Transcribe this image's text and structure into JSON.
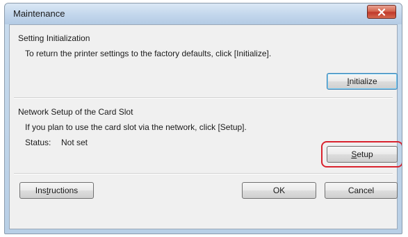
{
  "window": {
    "title": "Maintenance"
  },
  "setting_init": {
    "heading": "Setting Initialization",
    "description": "To return the printer settings to the factory defaults, click [Initialize].",
    "button": {
      "before": "",
      "accel": "I",
      "after": "nitialize"
    }
  },
  "network": {
    "heading": "Network Setup of the Card Slot",
    "description": "If you plan to use the card slot via the network, click [Setup].",
    "status_label": "Status:",
    "status_value": "Not set",
    "button": {
      "before": "",
      "accel": "S",
      "after": "etup"
    }
  },
  "footer": {
    "instructions": {
      "before": "Ins",
      "accel": "t",
      "after": "ructions"
    },
    "ok_label": "OK",
    "cancel_label": "Cancel"
  },
  "icons": {
    "close": "close-x-icon"
  },
  "colors": {
    "highlight": "#d9232e",
    "close_button": "#c0392b"
  }
}
